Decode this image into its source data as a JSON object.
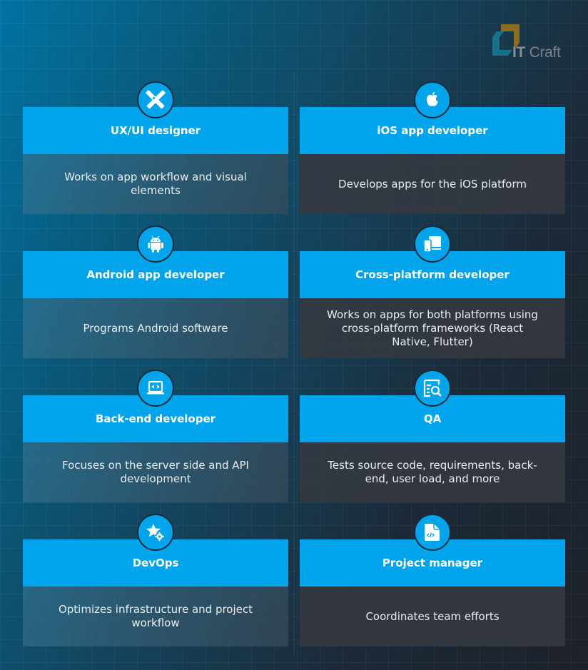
{
  "brand": {
    "logo_text_bold": "IT",
    "logo_text": "Craft"
  },
  "colors": {
    "accent": "#02a4eb",
    "logo_gold": "#8a6d1e",
    "logo_teal": "#17708c"
  },
  "roles": [
    {
      "title": "UX/UI designer",
      "description": "Works on app workflow and visual elements",
      "icon": "pencil-ruler-icon"
    },
    {
      "title": "iOS app developer",
      "description": "Develops apps for the iOS platform",
      "icon": "apple-icon"
    },
    {
      "title": "Android app developer",
      "description": "Programs Android software",
      "icon": "android-icon"
    },
    {
      "title": "Cross-platform developer",
      "description": "Works on apps for both platforms using cross-platform frameworks (React Native, Flutter)",
      "icon": "devices-icon"
    },
    {
      "title": "Back-end developer",
      "description": "Focuses on the server side and API development",
      "icon": "laptop-code-icon"
    },
    {
      "title": "QA",
      "description": "Tests source code, requirements, back-end, user load, and more",
      "icon": "search-document-icon"
    },
    {
      "title": "DevOps",
      "description": "Optimizes infrastructure and project workflow",
      "icon": "star-gear-icon"
    },
    {
      "title": "Project manager",
      "description": "Coordinates team efforts",
      "icon": "code-file-icon"
    }
  ]
}
